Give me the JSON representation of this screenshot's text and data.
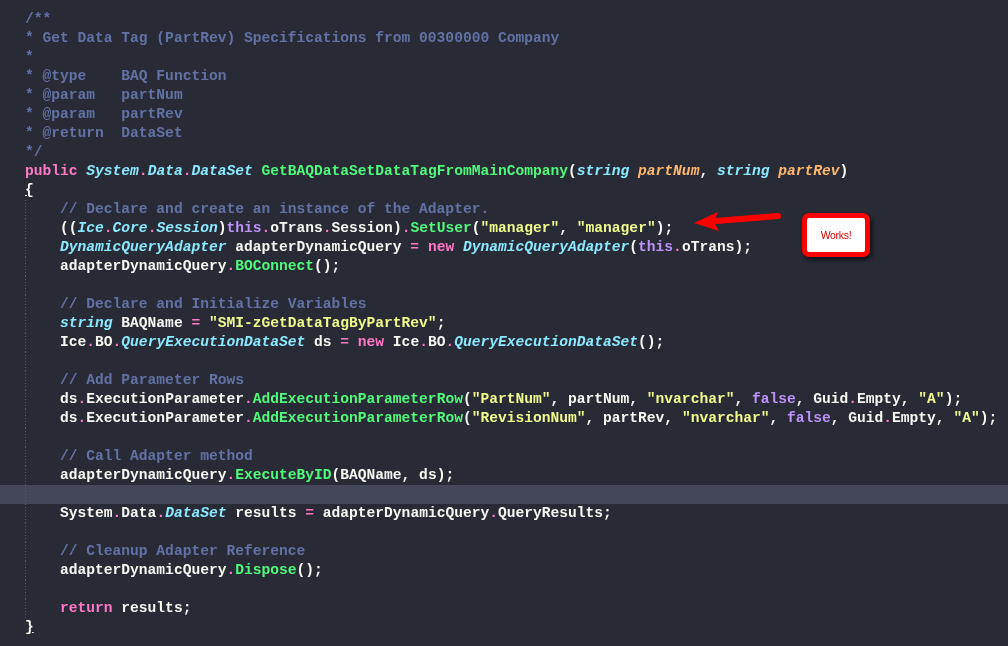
{
  "editor": {
    "lines": [
      {
        "current": false,
        "tokens": [
          {
            "kind": "comment",
            "text": "/**"
          }
        ]
      },
      {
        "current": false,
        "tokens": [
          {
            "kind": "comment",
            "text": "* Get Data Tag (PartRev) Specifications from 00300000 Company"
          }
        ]
      },
      {
        "current": false,
        "tokens": [
          {
            "kind": "comment",
            "text": "*"
          }
        ]
      },
      {
        "current": false,
        "tokens": [
          {
            "kind": "comment",
            "text": "* @type    BAQ Function"
          }
        ]
      },
      {
        "current": false,
        "tokens": [
          {
            "kind": "comment",
            "text": "* @param   partNum"
          }
        ]
      },
      {
        "current": false,
        "tokens": [
          {
            "kind": "comment",
            "text": "* @param   partRev"
          }
        ]
      },
      {
        "current": false,
        "tokens": [
          {
            "kind": "comment",
            "text": "* @return  DataSet"
          }
        ]
      },
      {
        "current": false,
        "tokens": [
          {
            "kind": "comment",
            "text": "*/"
          }
        ]
      },
      {
        "current": false,
        "tokens": [
          {
            "kind": "keyword",
            "text": "public"
          },
          {
            "kind": "type",
            "text": " System"
          },
          {
            "kind": "operator",
            "text": "."
          },
          {
            "kind": "type",
            "text": "Data"
          },
          {
            "kind": "operator",
            "text": "."
          },
          {
            "kind": "type",
            "text": "DataSet"
          },
          {
            "kind": "method",
            "text": " GetBAQDataSetDataTagFromMainCompany"
          },
          {
            "kind": "plain",
            "text": "("
          },
          {
            "kind": "type",
            "text": "string"
          },
          {
            "kind": "parameter",
            "text": " partNum"
          },
          {
            "kind": "plain",
            "text": ", "
          },
          {
            "kind": "type",
            "text": "string"
          },
          {
            "kind": "parameter",
            "text": " partRev"
          },
          {
            "kind": "plain",
            "text": ")"
          }
        ]
      },
      {
        "current": false,
        "tokens": [
          {
            "kind": "brace",
            "text": "{",
            "matched": true
          }
        ]
      },
      {
        "current": false,
        "tokens": [
          {
            "kind": "comment",
            "text": "    // Declare and create an instance of the Adapter."
          }
        ]
      },
      {
        "current": false,
        "tokens": [
          {
            "kind": "plain",
            "text": "    (("
          },
          {
            "kind": "type",
            "text": "Ice"
          },
          {
            "kind": "operator",
            "text": "."
          },
          {
            "kind": "type",
            "text": "Core"
          },
          {
            "kind": "operator",
            "text": "."
          },
          {
            "kind": "type",
            "text": "Session"
          },
          {
            "kind": "plain",
            "text": ")"
          },
          {
            "kind": "constant",
            "text": "this"
          },
          {
            "kind": "operator",
            "text": "."
          },
          {
            "kind": "plain",
            "text": "oTrans"
          },
          {
            "kind": "operator",
            "text": "."
          },
          {
            "kind": "plain",
            "text": "Session)"
          },
          {
            "kind": "operator",
            "text": "."
          },
          {
            "kind": "method",
            "text": "SetUser"
          },
          {
            "kind": "plain",
            "text": "("
          },
          {
            "kind": "string",
            "text": "\"manager\""
          },
          {
            "kind": "plain",
            "text": ", "
          },
          {
            "kind": "string",
            "text": "\"manager\""
          },
          {
            "kind": "plain",
            "text": ");"
          }
        ]
      },
      {
        "current": false,
        "tokens": [
          {
            "kind": "type",
            "text": "    DynamicQueryAdapter"
          },
          {
            "kind": "plain",
            "text": " adapterDynamicQuery "
          },
          {
            "kind": "operator",
            "text": "="
          },
          {
            "kind": "keyword",
            "text": " new"
          },
          {
            "kind": "type",
            "text": " DynamicQueryAdapter"
          },
          {
            "kind": "plain",
            "text": "("
          },
          {
            "kind": "constant",
            "text": "this"
          },
          {
            "kind": "operator",
            "text": "."
          },
          {
            "kind": "plain",
            "text": "oTrans);"
          }
        ]
      },
      {
        "current": false,
        "tokens": [
          {
            "kind": "plain",
            "text": "    adapterDynamicQuery"
          },
          {
            "kind": "operator",
            "text": "."
          },
          {
            "kind": "method",
            "text": "BOConnect"
          },
          {
            "kind": "plain",
            "text": "();"
          }
        ]
      },
      {
        "current": false
      },
      {
        "current": false,
        "tokens": [
          {
            "kind": "comment",
            "text": "    // Declare and Initialize Variables"
          }
        ]
      },
      {
        "current": false,
        "tokens": [
          {
            "kind": "type",
            "text": "    string"
          },
          {
            "kind": "plain",
            "text": " BAQName "
          },
          {
            "kind": "operator",
            "text": "="
          },
          {
            "kind": "string",
            "text": " \"SMI-zGetDataTagByPartRev\""
          },
          {
            "kind": "plain",
            "text": ";"
          }
        ]
      },
      {
        "current": false,
        "tokens": [
          {
            "kind": "plain",
            "text": "    Ice"
          },
          {
            "kind": "operator",
            "text": "."
          },
          {
            "kind": "plain",
            "text": "BO"
          },
          {
            "kind": "operator",
            "text": "."
          },
          {
            "kind": "type",
            "text": "QueryExecutionDataSet"
          },
          {
            "kind": "plain",
            "text": " ds "
          },
          {
            "kind": "operator",
            "text": "="
          },
          {
            "kind": "keyword",
            "text": " new"
          },
          {
            "kind": "plain",
            "text": " Ice"
          },
          {
            "kind": "operator",
            "text": "."
          },
          {
            "kind": "plain",
            "text": "BO"
          },
          {
            "kind": "operator",
            "text": "."
          },
          {
            "kind": "type",
            "text": "QueryExecutionDataSet"
          },
          {
            "kind": "plain",
            "text": "();"
          }
        ]
      },
      {
        "current": false
      },
      {
        "current": false,
        "tokens": [
          {
            "kind": "comment",
            "text": "    // Add Parameter Rows"
          }
        ]
      },
      {
        "current": false,
        "tokens": [
          {
            "kind": "plain",
            "text": "    ds"
          },
          {
            "kind": "operator",
            "text": "."
          },
          {
            "kind": "plain",
            "text": "ExecutionParameter"
          },
          {
            "kind": "operator",
            "text": "."
          },
          {
            "kind": "method",
            "text": "AddExecutionParameterRow"
          },
          {
            "kind": "plain",
            "text": "("
          },
          {
            "kind": "string",
            "text": "\"PartNum\""
          },
          {
            "kind": "plain",
            "text": ", partNum, "
          },
          {
            "kind": "string",
            "text": "\"nvarchar\""
          },
          {
            "kind": "plain",
            "text": ", "
          },
          {
            "kind": "constant",
            "text": "false"
          },
          {
            "kind": "plain",
            "text": ", Guid"
          },
          {
            "kind": "operator",
            "text": "."
          },
          {
            "kind": "plain",
            "text": "Empty, "
          },
          {
            "kind": "string",
            "text": "\"A\""
          },
          {
            "kind": "plain",
            "text": ");"
          }
        ]
      },
      {
        "current": false,
        "tokens": [
          {
            "kind": "plain",
            "text": "    ds"
          },
          {
            "kind": "operator",
            "text": "."
          },
          {
            "kind": "plain",
            "text": "ExecutionParameter"
          },
          {
            "kind": "operator",
            "text": "."
          },
          {
            "kind": "method",
            "text": "AddExecutionParameterRow"
          },
          {
            "kind": "plain",
            "text": "("
          },
          {
            "kind": "string",
            "text": "\"RevisionNum\""
          },
          {
            "kind": "plain",
            "text": ", partRev, "
          },
          {
            "kind": "string",
            "text": "\"nvarchar\""
          },
          {
            "kind": "plain",
            "text": ", "
          },
          {
            "kind": "constant",
            "text": "false"
          },
          {
            "kind": "plain",
            "text": ", Guid"
          },
          {
            "kind": "operator",
            "text": "."
          },
          {
            "kind": "plain",
            "text": "Empty, "
          },
          {
            "kind": "string",
            "text": "\"A\""
          },
          {
            "kind": "plain",
            "text": ");"
          }
        ]
      },
      {
        "current": false
      },
      {
        "current": false,
        "tokens": [
          {
            "kind": "comment",
            "text": "    // Call Adapter method"
          }
        ]
      },
      {
        "current": false,
        "tokens": [
          {
            "kind": "plain",
            "text": "    adapterDynamicQuery"
          },
          {
            "kind": "operator",
            "text": "."
          },
          {
            "kind": "method",
            "text": "ExecuteByID"
          },
          {
            "kind": "plain",
            "text": "(BAQName, ds);"
          }
        ]
      },
      {
        "current": true
      },
      {
        "current": false,
        "tokens": [
          {
            "kind": "plain",
            "text": "    System"
          },
          {
            "kind": "operator",
            "text": "."
          },
          {
            "kind": "plain",
            "text": "Data"
          },
          {
            "kind": "operator",
            "text": "."
          },
          {
            "kind": "type",
            "text": "DataSet"
          },
          {
            "kind": "plain",
            "text": " results "
          },
          {
            "kind": "operator",
            "text": "="
          },
          {
            "kind": "plain",
            "text": " adapterDynamicQuery"
          },
          {
            "kind": "operator",
            "text": "."
          },
          {
            "kind": "plain",
            "text": "QueryResults;"
          }
        ]
      },
      {
        "current": false
      },
      {
        "current": false,
        "tokens": [
          {
            "kind": "comment",
            "text": "    // Cleanup Adapter Reference"
          }
        ]
      },
      {
        "current": false,
        "tokens": [
          {
            "kind": "plain",
            "text": "    adapterDynamicQuery"
          },
          {
            "kind": "operator",
            "text": "."
          },
          {
            "kind": "method",
            "text": "Dispose"
          },
          {
            "kind": "plain",
            "text": "();"
          }
        ]
      },
      {
        "current": false
      },
      {
        "current": false,
        "tokens": [
          {
            "kind": "keyword",
            "text": "    return"
          },
          {
            "kind": "plain",
            "text": " results;"
          }
        ]
      },
      {
        "current": false,
        "tokens": [
          {
            "kind": "brace",
            "text": "}",
            "matched": true
          }
        ]
      }
    ]
  },
  "callout": {
    "text": "Works!"
  }
}
